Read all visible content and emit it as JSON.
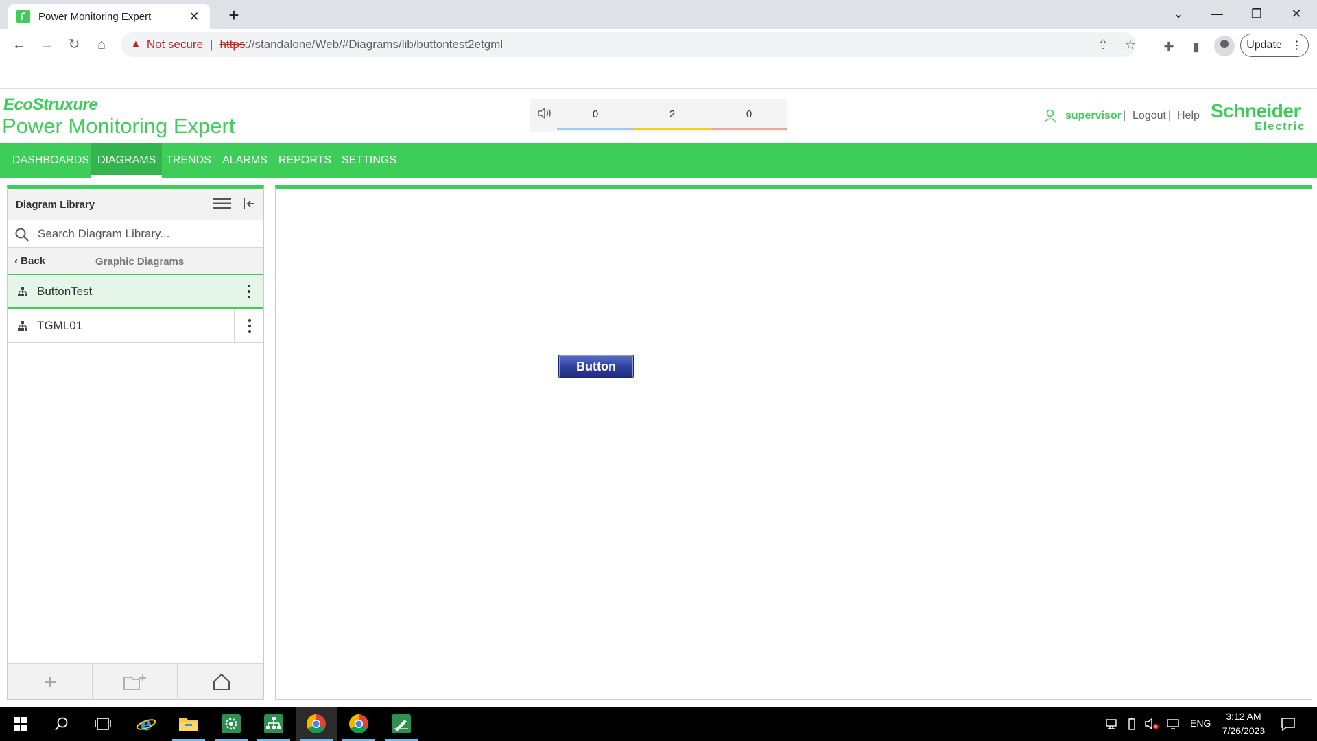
{
  "browser": {
    "tab_title": "Power Monitoring Expert",
    "security_label": "Not secure",
    "url_scheme": "https",
    "url_rest": "://standalone/Web/#Diagrams/lib/buttontest2etgml",
    "update_label": "Update"
  },
  "app": {
    "brand": "EcoStruxure",
    "title": "Power Monitoring Expert",
    "alarms": [
      {
        "count": "0",
        "color": "#9ccbef"
      },
      {
        "count": "2",
        "color": "#f0d21c"
      },
      {
        "count": "0",
        "color": "#f2a494"
      }
    ],
    "user": "supervisor",
    "logout": "Logout",
    "help": "Help",
    "separator": "|",
    "logo_line1": "Schneider",
    "logo_line2": "Electric"
  },
  "nav": {
    "items": [
      "DASHBOARDS",
      "DIAGRAMS",
      "TRENDS",
      "ALARMS",
      "REPORTS",
      "SETTINGS"
    ],
    "active": "DIAGRAMS"
  },
  "library": {
    "title": "Diagram Library",
    "search_placeholder": "Search Diagram Library...",
    "back_label": "Back",
    "crumb": "Graphic Diagrams",
    "items": [
      {
        "label": "ButtonTest",
        "selected": true
      },
      {
        "label": "TGML01",
        "selected": false
      }
    ]
  },
  "diagram": {
    "button_label": "Button"
  },
  "taskbar": {
    "lang": "ENG",
    "time": "3:12 AM",
    "date": "7/26/2023"
  },
  "colors": {
    "accent": "#3dcd58",
    "taskbar": "#000000"
  }
}
